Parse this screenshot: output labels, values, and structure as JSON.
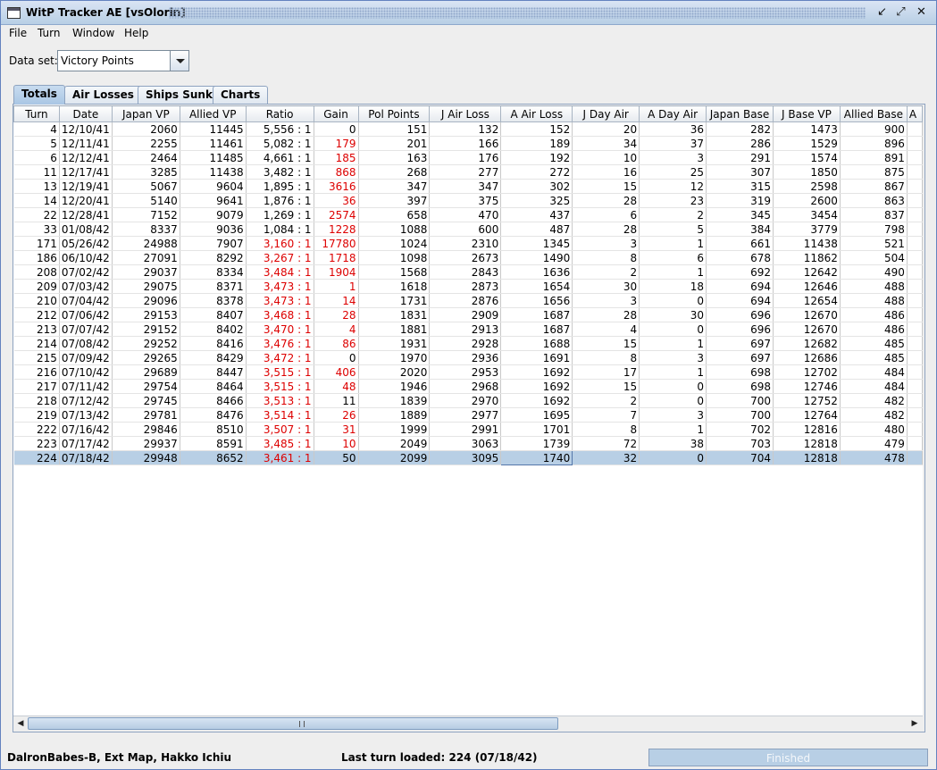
{
  "window": {
    "title": "WitP Tracker AE [vsOlorin]"
  },
  "menu": [
    "File",
    "Turn",
    "Window",
    "Help"
  ],
  "dataset": {
    "label": "Data set:",
    "value": "Victory Points"
  },
  "tabs": [
    "Totals",
    "Air Losses",
    "Ships Sunk",
    "Charts"
  ],
  "table": {
    "columns": [
      "Turn",
      "Date",
      "Japan VP",
      "Allied VP",
      "Ratio",
      "Gain",
      "Pol Points",
      "J Air Loss",
      "A Air Loss",
      "J Day Air",
      "A Day Air",
      "Japan Base",
      "J Base VP",
      "Allied Base",
      "A"
    ],
    "rows": [
      [
        "4",
        "12/10/41",
        "2060",
        "11445",
        "5,556 : 1",
        "0",
        "151",
        "132",
        "152",
        "20",
        "36",
        "282",
        "1473",
        "900"
      ],
      [
        "5",
        "12/11/41",
        "2255",
        "11461",
        "5,082 : 1",
        "179",
        "201",
        "166",
        "189",
        "34",
        "37",
        "286",
        "1529",
        "896"
      ],
      [
        "6",
        "12/12/41",
        "2464",
        "11485",
        "4,661 : 1",
        "185",
        "163",
        "176",
        "192",
        "10",
        "3",
        "291",
        "1574",
        "891"
      ],
      [
        "11",
        "12/17/41",
        "3285",
        "11438",
        "3,482 : 1",
        "868",
        "268",
        "277",
        "272",
        "16",
        "25",
        "307",
        "1850",
        "875"
      ],
      [
        "13",
        "12/19/41",
        "5067",
        "9604",
        "1,895 : 1",
        "3616",
        "347",
        "347",
        "302",
        "15",
        "12",
        "315",
        "2598",
        "867"
      ],
      [
        "14",
        "12/20/41",
        "5140",
        "9641",
        "1,876 : 1",
        "36",
        "397",
        "375",
        "325",
        "28",
        "23",
        "319",
        "2600",
        "863"
      ],
      [
        "22",
        "12/28/41",
        "7152",
        "9079",
        "1,269 : 1",
        "2574",
        "658",
        "470",
        "437",
        "6",
        "2",
        "345",
        "3454",
        "837"
      ],
      [
        "33",
        "01/08/42",
        "8337",
        "9036",
        "1,084 : 1",
        "1228",
        "1088",
        "600",
        "487",
        "28",
        "5",
        "384",
        "3779",
        "798"
      ],
      [
        "171",
        "05/26/42",
        "24988",
        "7907",
        "3,160 : 1",
        "17780",
        "1024",
        "2310",
        "1345",
        "3",
        "1",
        "661",
        "11438",
        "521"
      ],
      [
        "186",
        "06/10/42",
        "27091",
        "8292",
        "3,267 : 1",
        "1718",
        "1098",
        "2673",
        "1490",
        "8",
        "6",
        "678",
        "11862",
        "504"
      ],
      [
        "208",
        "07/02/42",
        "29037",
        "8334",
        "3,484 : 1",
        "1904",
        "1568",
        "2843",
        "1636",
        "2",
        "1",
        "692",
        "12642",
        "490"
      ],
      [
        "209",
        "07/03/42",
        "29075",
        "8371",
        "3,473 : 1",
        "1",
        "1618",
        "2873",
        "1654",
        "30",
        "18",
        "694",
        "12646",
        "488"
      ],
      [
        "210",
        "07/04/42",
        "29096",
        "8378",
        "3,473 : 1",
        "14",
        "1731",
        "2876",
        "1656",
        "3",
        "0",
        "694",
        "12654",
        "488"
      ],
      [
        "212",
        "07/06/42",
        "29153",
        "8407",
        "3,468 : 1",
        "28",
        "1831",
        "2909",
        "1687",
        "28",
        "30",
        "696",
        "12670",
        "486"
      ],
      [
        "213",
        "07/07/42",
        "29152",
        "8402",
        "3,470 : 1",
        "4",
        "1881",
        "2913",
        "1687",
        "4",
        "0",
        "696",
        "12670",
        "486"
      ],
      [
        "214",
        "07/08/42",
        "29252",
        "8416",
        "3,476 : 1",
        "86",
        "1931",
        "2928",
        "1688",
        "15",
        "1",
        "697",
        "12682",
        "485"
      ],
      [
        "215",
        "07/09/42",
        "29265",
        "8429",
        "3,472 : 1",
        "0",
        "1970",
        "2936",
        "1691",
        "8",
        "3",
        "697",
        "12686",
        "485"
      ],
      [
        "216",
        "07/10/42",
        "29689",
        "8447",
        "3,515 : 1",
        "406",
        "2020",
        "2953",
        "1692",
        "17",
        "1",
        "698",
        "12702",
        "484"
      ],
      [
        "217",
        "07/11/42",
        "29754",
        "8464",
        "3,515 : 1",
        "48",
        "1946",
        "2968",
        "1692",
        "15",
        "0",
        "698",
        "12746",
        "484"
      ],
      [
        "218",
        "07/12/42",
        "29745",
        "8466",
        "3,513 : 1",
        "11",
        "1839",
        "2970",
        "1692",
        "2",
        "0",
        "700",
        "12752",
        "482"
      ],
      [
        "219",
        "07/13/42",
        "29781",
        "8476",
        "3,514 : 1",
        "26",
        "1889",
        "2977",
        "1695",
        "7",
        "3",
        "700",
        "12764",
        "482"
      ],
      [
        "222",
        "07/16/42",
        "29846",
        "8510",
        "3,507 : 1",
        "31",
        "1999",
        "2991",
        "1701",
        "8",
        "1",
        "702",
        "12816",
        "480"
      ],
      [
        "223",
        "07/17/42",
        "29937",
        "8591",
        "3,485 : 1",
        "10",
        "2049",
        "3063",
        "1739",
        "72",
        "38",
        "703",
        "12818",
        "479"
      ],
      [
        "224",
        "07/18/42",
        "29948",
        "8652",
        "3,461 : 1",
        "50",
        "2099",
        "3095",
        "1740",
        "32",
        "0",
        "704",
        "12818",
        "478"
      ]
    ],
    "ratio_red": [
      false,
      false,
      false,
      false,
      false,
      false,
      false,
      false,
      true,
      true,
      true,
      true,
      true,
      true,
      true,
      true,
      true,
      true,
      true,
      true,
      true,
      true,
      true,
      true
    ],
    "gain_red": [
      false,
      true,
      true,
      true,
      true,
      true,
      true,
      true,
      true,
      true,
      true,
      true,
      true,
      true,
      true,
      true,
      false,
      true,
      true,
      false,
      true,
      true,
      true,
      false
    ],
    "selected_row": 23
  },
  "status": {
    "left": "DalronBabes-B, Ext Map, Hakko Ichiu",
    "center": "Last turn loaded: 224 (07/18/42)",
    "progress_text": "Finished",
    "progress_fraction": 1.0
  },
  "colors": {
    "selection": "#b8cfe5",
    "red_text": "#dd0000"
  }
}
